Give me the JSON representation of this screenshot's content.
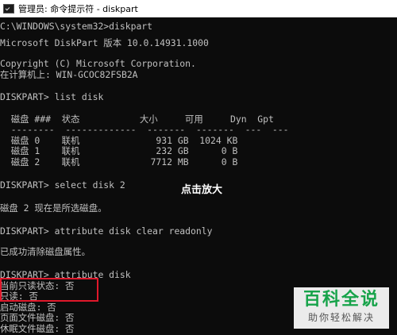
{
  "window": {
    "title": "管理员: 命令提示符 - diskpart",
    "icon": "cmd-icon"
  },
  "terminal": {
    "lines": [
      "C:\\WINDOWS\\system32>diskpart",
      "",
      "Microsoft DiskPart 版本 10.0.14931.1000",
      "",
      "Copyright (C) Microsoft Corporation.",
      "在计算机上: WIN-GCOC82FSB2A",
      "",
      "DISKPART> list disk",
      "",
      "  磁盘 ###  状态           大小     可用     Dyn  Gpt",
      "  --------  -------------  -------  -------  ---  ---",
      "  磁盘 0    联机              931 GB  1024 KB",
      "  磁盘 1    联机              232 GB      0 B",
      "  磁盘 2    联机             7712 MB      0 B",
      "",
      "DISKPART> select disk 2",
      "",
      "磁盘 2 现在是所选磁盘。",
      "",
      "DISKPART> attribute disk clear readonly",
      "",
      "已成功清除磁盘属性。",
      "",
      "DISKPART> attribute disk",
      "当前只读状态: 否",
      "只读: 否",
      "启动磁盘: 否",
      "页面文件磁盘: 否",
      "休眠文件磁盘: 否"
    ]
  },
  "overlay": {
    "caption": "点击放大"
  },
  "watermark": {
    "title": "百科全说",
    "subtitle": "助你轻松解决"
  },
  "colors": {
    "terminal_bg": "#0c0c0c",
    "terminal_text": "#c0c0c0",
    "highlight": "#e0182b",
    "watermark_green": "#17a34a"
  }
}
